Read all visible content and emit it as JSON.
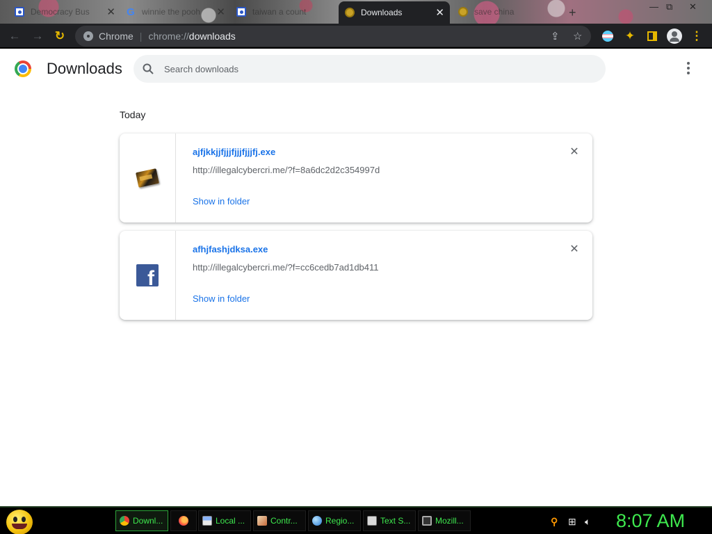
{
  "browser": {
    "tabs": [
      {
        "label": "Democracy Bus",
        "favicon": "paw-icon",
        "active": false
      },
      {
        "label": "winnie the pooh",
        "favicon": "google-icon",
        "active": false
      },
      {
        "label": "taiwan a count",
        "favicon": "paw-icon",
        "active": false
      },
      {
        "label": "Downloads",
        "favicon": "chrome-icon",
        "active": true
      },
      {
        "label": "save china",
        "favicon": "coin-icon",
        "active": false
      }
    ],
    "omnibox": {
      "chip": "Chrome",
      "scheme": "chrome://",
      "host": "downloads"
    }
  },
  "page": {
    "title": "Downloads",
    "search_placeholder": "Search downloads",
    "section_title": "Today"
  },
  "downloads": [
    {
      "filename": "ajfjkkjjfjjjfjjjfjjjfj.exe",
      "url": "http://illegalcybercri.me/?f=8a6dc2d2c354997d",
      "action": "Show in folder",
      "icon": "exe-file-icon"
    },
    {
      "filename": "afhjfashjdksa.exe",
      "url": "http://illegalcybercri.me/?f=cc6cedb7ad1db411",
      "action": "Show in folder",
      "icon": "facebook-icon"
    }
  ],
  "taskbar": {
    "items": [
      {
        "label": "Downl...",
        "icon": "chrome-icon",
        "active": true
      },
      {
        "label": "",
        "icon": "firefox-icon",
        "active": false
      },
      {
        "label": "Local ...",
        "icon": "drive-icon",
        "active": false
      },
      {
        "label": "Contr...",
        "icon": "control-panel-icon",
        "active": false
      },
      {
        "label": "Regio...",
        "icon": "globe-icon",
        "active": false
      },
      {
        "label": "Text S...",
        "icon": "keyboard-icon",
        "active": false
      },
      {
        "label": "Mozill...",
        "icon": "window-icon",
        "active": false
      }
    ],
    "clock": "8:07 AM"
  },
  "colors": {
    "link": "#1a73e8",
    "taskbar_text": "#3ee84e",
    "toolbar": "#202124"
  }
}
